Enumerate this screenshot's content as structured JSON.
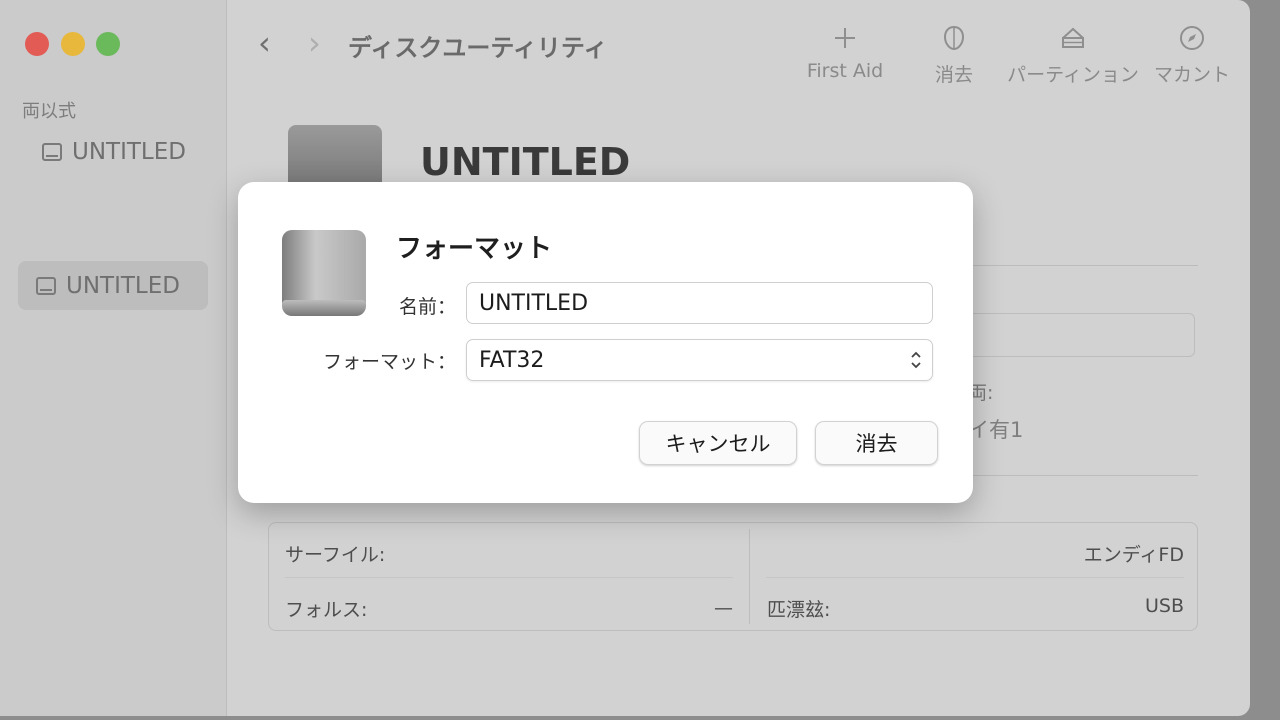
{
  "window": {
    "title": "ディスクユーティリティ",
    "nav": {
      "back": "‹",
      "forward": "›"
    }
  },
  "sidebar": {
    "section_label": "両以式",
    "items": [
      {
        "label": "UNTITLED"
      },
      {
        "label": "UNTITLED",
        "selected": true
      }
    ]
  },
  "toolbar": {
    "first_aid": {
      "label": "First Aid",
      "icon": "plus-icon"
    },
    "erase": {
      "label": "消去",
      "icon": "erase-icon"
    },
    "partition": {
      "label": "パーティンョン",
      "icon": "partition-icon"
    },
    "mount": {
      "label": "マカント",
      "icon": "mount-icon"
    }
  },
  "main": {
    "title": "UNTITLED",
    "background_fragments": [
      "両:",
      "イ有1"
    ],
    "info": {
      "left": [
        {
          "label": "サーフイル:",
          "value": ""
        },
        {
          "label": "フォルス:",
          "value": "—"
        }
      ],
      "right": [
        {
          "label": "",
          "value": "エンディFD"
        },
        {
          "label": "匹漂玆:",
          "value": "USB"
        }
      ]
    }
  },
  "dialog": {
    "title": "フォーマット",
    "name_label": "名前：",
    "name_value": "UNTITLED",
    "format_label": "フォーマット：",
    "format_value": "FAT32",
    "cancel_label": "キャンセル",
    "erase_label": "消去"
  },
  "colors": {
    "close": "#e25b55",
    "minimize": "#e7b83c",
    "zoom": "#6ab95b"
  }
}
